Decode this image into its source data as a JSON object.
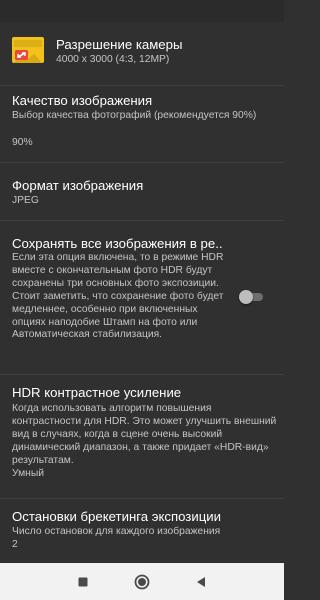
{
  "settings": {
    "resolution": {
      "title": "Разрешение камеры",
      "summary": "4000 x 3000 (4:3, 12MP)",
      "icon": "camera-resolution-icon"
    },
    "quality": {
      "title": "Качество изображения",
      "summary": "Выбор качества фотографий (рекомендуется 90%)",
      "value": "90%"
    },
    "format": {
      "title": "Формат изображения",
      "value": "JPEG"
    },
    "save_all": {
      "title": "Сохранять все изображения в ре..",
      "summary": "Если эта опция включена, то в режиме HDR вместе с окончательным фото HDR будут сохранены три основных фото экспозиции. Стоит заметить, что сохранение фото будет медленнее, особенно при включенных опциях наподобие Штамп на фото или Автоматическая стабилизация.",
      "enabled": false
    },
    "hdr_contrast": {
      "title": "HDR контрастное усиление",
      "summary": "Когда использовать алгоритм повышения контрастности для HDR. Это может улучшить внешний вид в случаях, когда в сцене очень высокий динамический диапазон, а также придает «HDR-вид» результатам.",
      "value": "Умный"
    },
    "bracketing": {
      "title": "Остановки брекетинга экспозиции",
      "summary": "Число остановок для каждого изображения",
      "value": "2"
    }
  },
  "nav": {
    "recents_icon": "square-recents-icon",
    "home_icon": "circle-home-icon",
    "back_icon": "triangle-back-icon"
  },
  "colors": {
    "background": "#303030",
    "title_text": "#ffffff",
    "summary_text": "#c4c4c4",
    "icon_yellow": "#f2c11b",
    "icon_red": "#e84a3a",
    "nav_bar": "#f2f2f2"
  }
}
